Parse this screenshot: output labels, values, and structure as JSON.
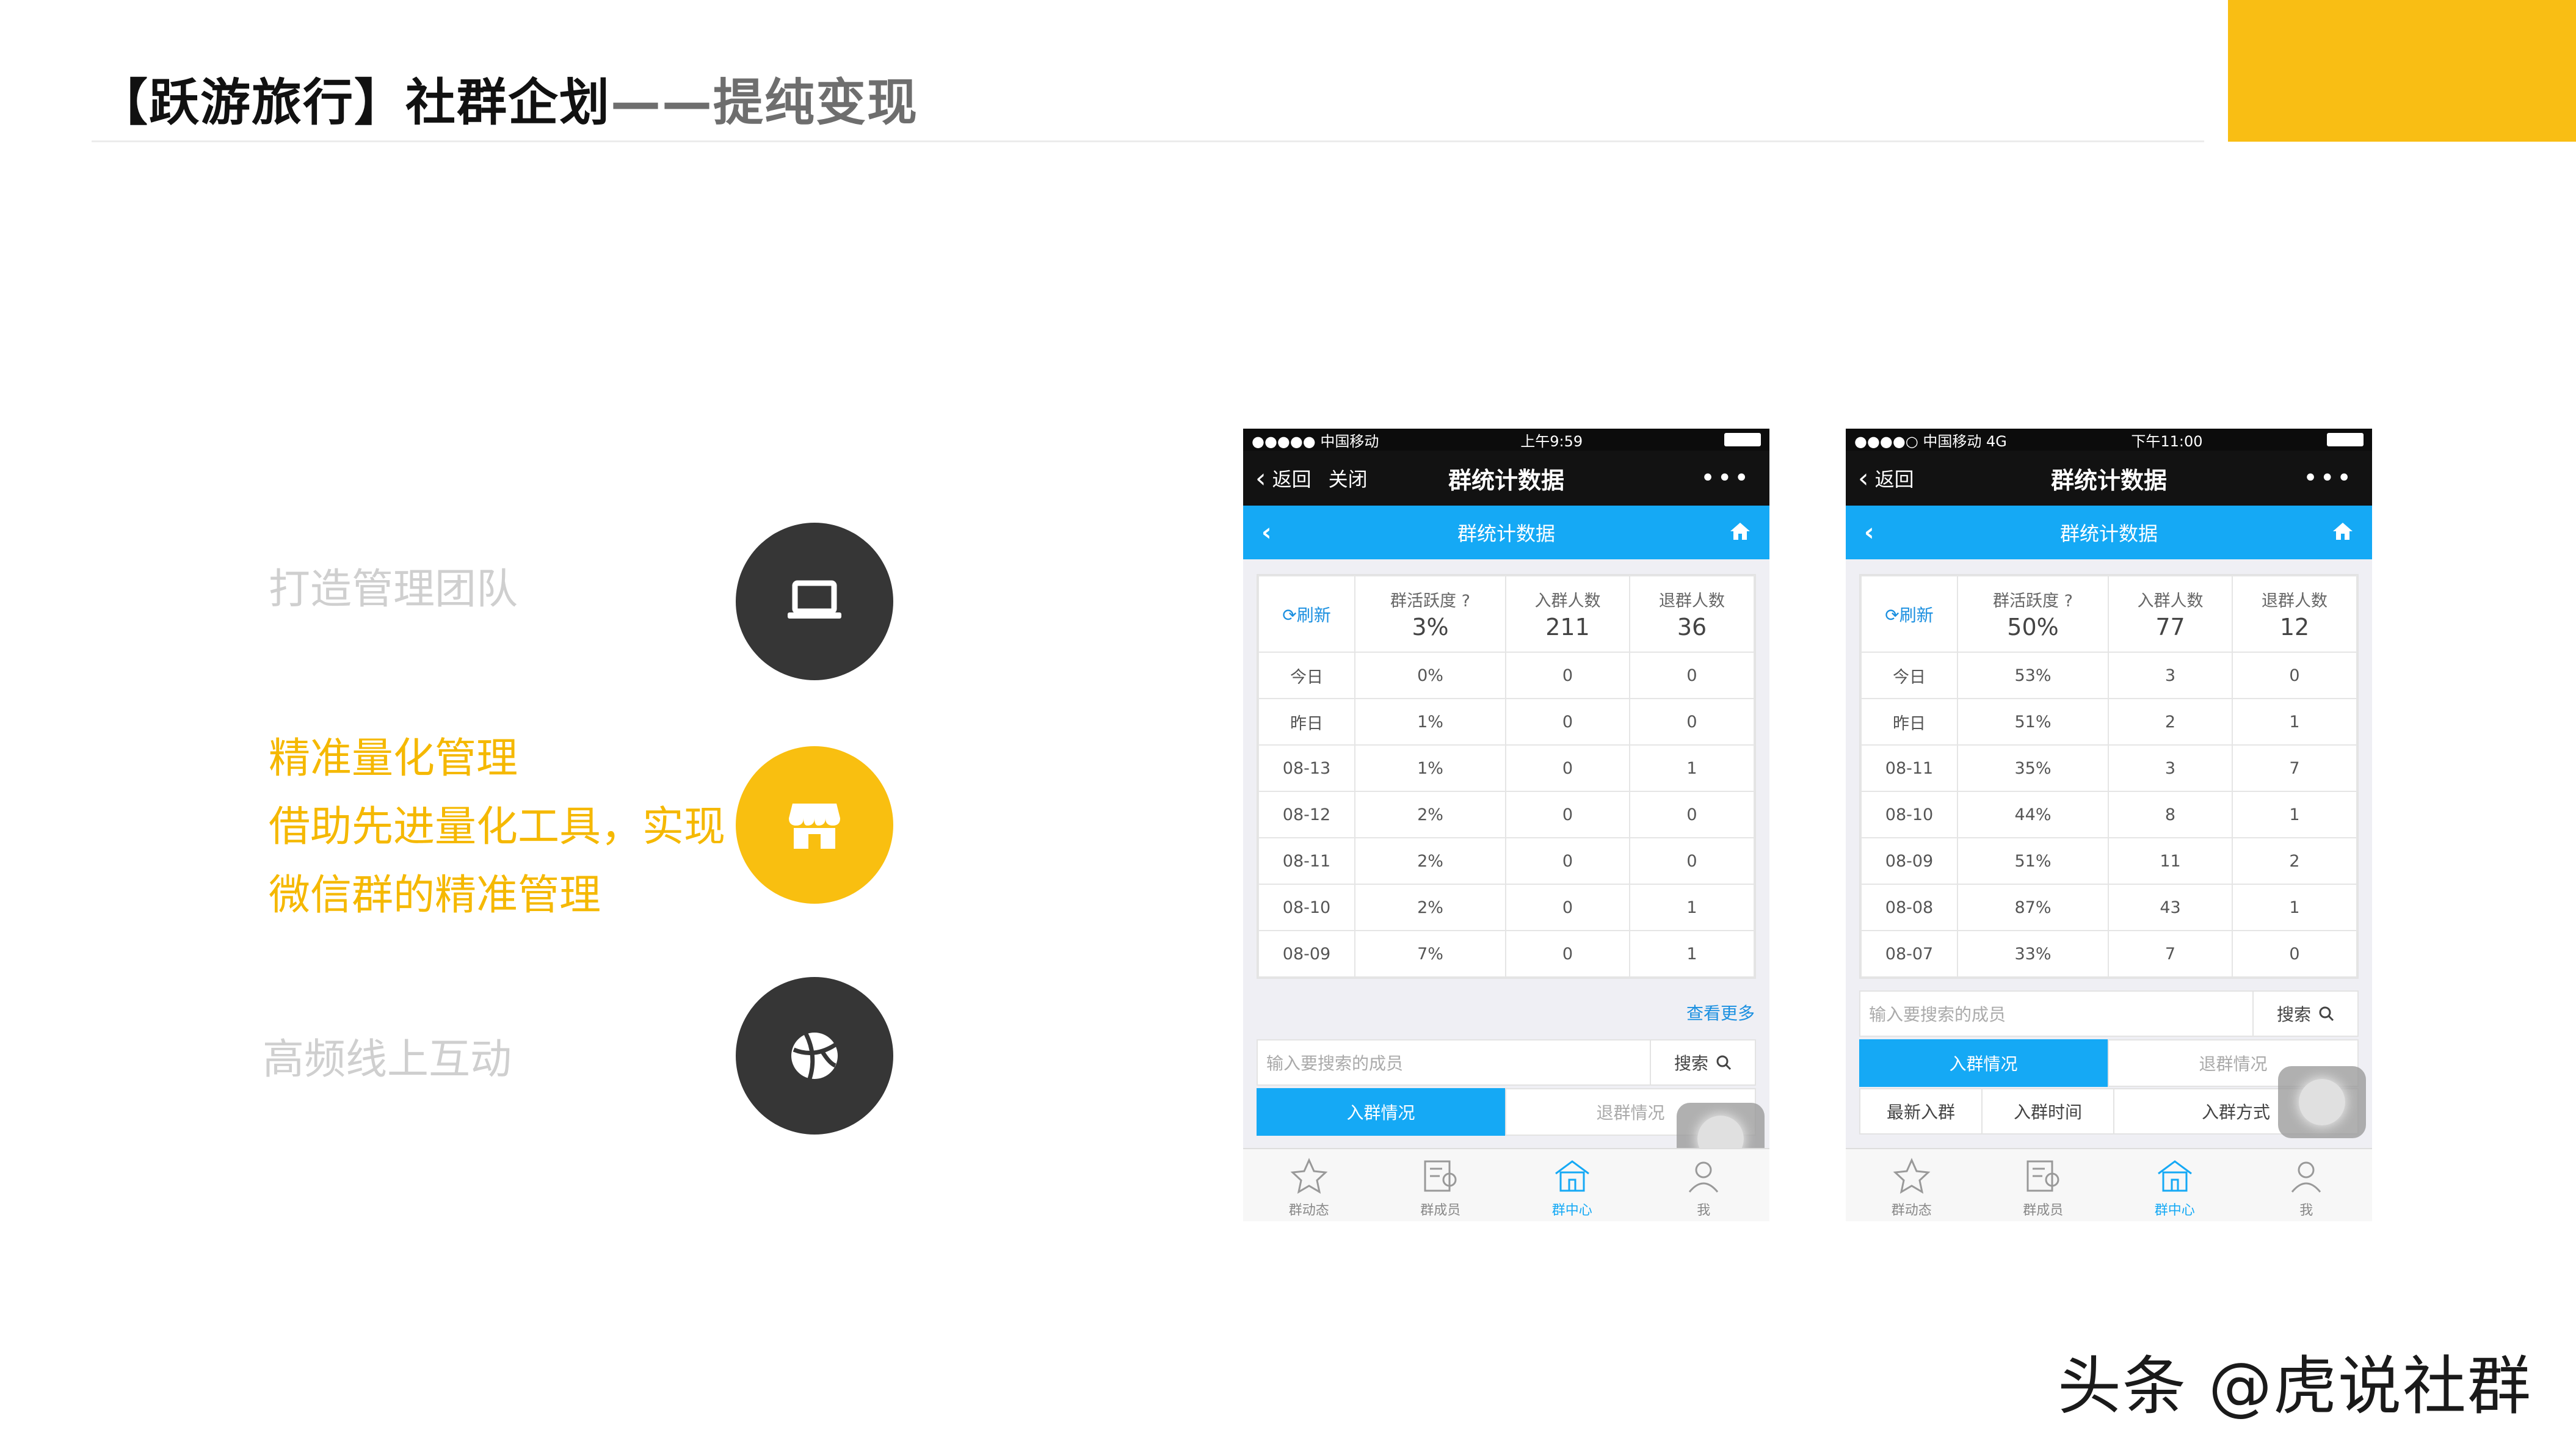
{
  "slide": {
    "title_main": "【跃游旅行】社群企划",
    "title_sub": "——提纯变现",
    "accent_color": "#f9be14"
  },
  "features": [
    {
      "lines": [
        "打造管理团队"
      ],
      "icon": "laptop-icon",
      "color": "gray"
    },
    {
      "lines": [
        "精准量化管理",
        "借助先进量化工具，实现",
        "微信群的精准管理"
      ],
      "icon": "store-icon",
      "color": "yellow"
    },
    {
      "lines": [
        "高频线上互动"
      ],
      "icon": "ball-icon",
      "color": "gray"
    }
  ],
  "phone1": {
    "status_left": "●●●●● 中国移动",
    "status_time": "上午9:59",
    "nav_back": "返回",
    "nav_close": "关闭",
    "nav_title": "群统计数据",
    "nav_more": "•••",
    "subnav_title": "群统计数据",
    "header": {
      "refresh": "刷新",
      "active_label": "群活跃度",
      "active_value": "3%",
      "join_label": "入群人数",
      "join_value": "211",
      "leave_label": "退群人数",
      "leave_value": "36"
    },
    "rows": [
      [
        "今日",
        "0%",
        "0",
        "0"
      ],
      [
        "昨日",
        "1%",
        "0",
        "0"
      ],
      [
        "08-13",
        "1%",
        "0",
        "1"
      ],
      [
        "08-12",
        "2%",
        "0",
        "0"
      ],
      [
        "08-11",
        "2%",
        "0",
        "0"
      ],
      [
        "08-10",
        "2%",
        "0",
        "1"
      ],
      [
        "08-09",
        "7%",
        "0",
        "1"
      ]
    ],
    "more": "查看更多",
    "search_placeholder": "输入要搜索的成员",
    "search_btn": "搜索",
    "tab_join": "入群情况",
    "tab_leave": "退群情况",
    "tabbar": [
      "群动态",
      "群成员",
      "群中心",
      "我"
    ]
  },
  "phone2": {
    "status_left": "●●●●○ 中国移动 4G",
    "status_time": "下午11:00",
    "nav_back": "返回",
    "nav_title": "群统计数据",
    "nav_more": "•••",
    "subnav_title": "群统计数据",
    "header": {
      "refresh": "刷新",
      "active_label": "群活跃度",
      "active_value": "50%",
      "join_label": "入群人数",
      "join_value": "77",
      "leave_label": "退群人数",
      "leave_value": "12"
    },
    "rows": [
      [
        "今日",
        "53%",
        "3",
        "0"
      ],
      [
        "昨日",
        "51%",
        "2",
        "1"
      ],
      [
        "08-11",
        "35%",
        "3",
        "7"
      ],
      [
        "08-10",
        "44%",
        "8",
        "1"
      ],
      [
        "08-09",
        "51%",
        "11",
        "2"
      ],
      [
        "08-08",
        "87%",
        "43",
        "1"
      ],
      [
        "08-07",
        "33%",
        "7",
        "0"
      ]
    ],
    "search_placeholder": "输入要搜索的成员",
    "search_btn": "搜索",
    "tab_join": "入群情况",
    "tab_leave": "退群情况",
    "subtabs": [
      "最新入群",
      "入群时间",
      "入群方式"
    ],
    "tabbar": [
      "群动态",
      "群成员",
      "群中心",
      "我"
    ]
  },
  "watermark": "头条 @虎说社群"
}
